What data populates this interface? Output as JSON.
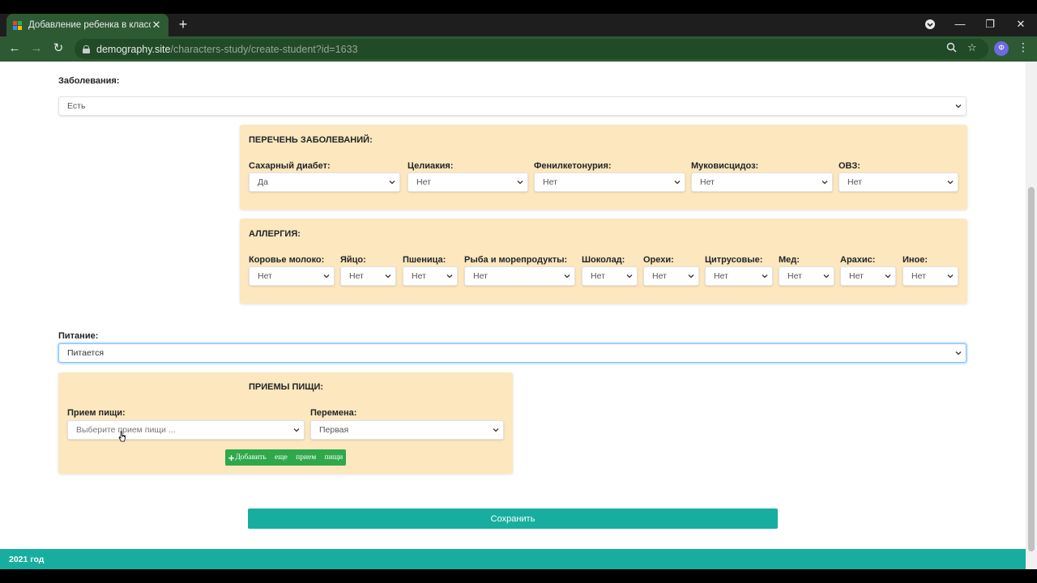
{
  "browser": {
    "tab_title": "Добавление ребенка в класс",
    "tab_close": "✕",
    "new_tab": "+",
    "url_domain": "demography.site",
    "url_path": "/characters-study/create-student?id=1633",
    "profile_initial": "Ф"
  },
  "form": {
    "diseases": {
      "label": "Заболевания:",
      "value": "Есть"
    },
    "disease_list": {
      "title": "ПЕРЕЧЕНЬ ЗАБОЛЕВАНИЙ:",
      "fields": [
        {
          "label": "Сахарный диабет:",
          "value": "Да"
        },
        {
          "label": "Целиакия:",
          "value": "Нет"
        },
        {
          "label": "Фенилкетонурия:",
          "value": "Нет"
        },
        {
          "label": "Муковисцидоз:",
          "value": "Нет"
        },
        {
          "label": "ОВЗ:",
          "value": "Нет"
        }
      ]
    },
    "allergy": {
      "title": "АЛЛЕРГИЯ:",
      "fields": [
        {
          "label": "Коровье молоко:",
          "value": "Нет"
        },
        {
          "label": "Яйцо:",
          "value": "Нет"
        },
        {
          "label": "Пшеница:",
          "value": "Нет"
        },
        {
          "label": "Рыба и морепродукты:",
          "value": "Нет"
        },
        {
          "label": "Шоколад:",
          "value": "Нет"
        },
        {
          "label": "Орехи:",
          "value": "Нет"
        },
        {
          "label": "Цитрусовые:",
          "value": "Нет"
        },
        {
          "label": "Мед:",
          "value": "Нет"
        },
        {
          "label": "Арахис:",
          "value": "Нет"
        },
        {
          "label": "Иное:",
          "value": "Нет"
        }
      ]
    },
    "nutrition": {
      "label": "Питание:",
      "value": "Питается"
    },
    "meals": {
      "title": "ПРИЕМЫ ПИЩИ:",
      "meal_label": "Прием пищи:",
      "meal_placeholder": "Выберите прием пищи ...",
      "break_label": "Перемена:",
      "break_value": "Первая",
      "add_button": "Добавить еще прием пищи"
    },
    "save_button": "Сохранить"
  },
  "footer": {
    "text": "2021 год"
  },
  "colors": {
    "panel": "#fce7be",
    "accent_teal": "#17aea0",
    "add_green": "#2ea84a",
    "chrome_green": "#2d5a32"
  }
}
